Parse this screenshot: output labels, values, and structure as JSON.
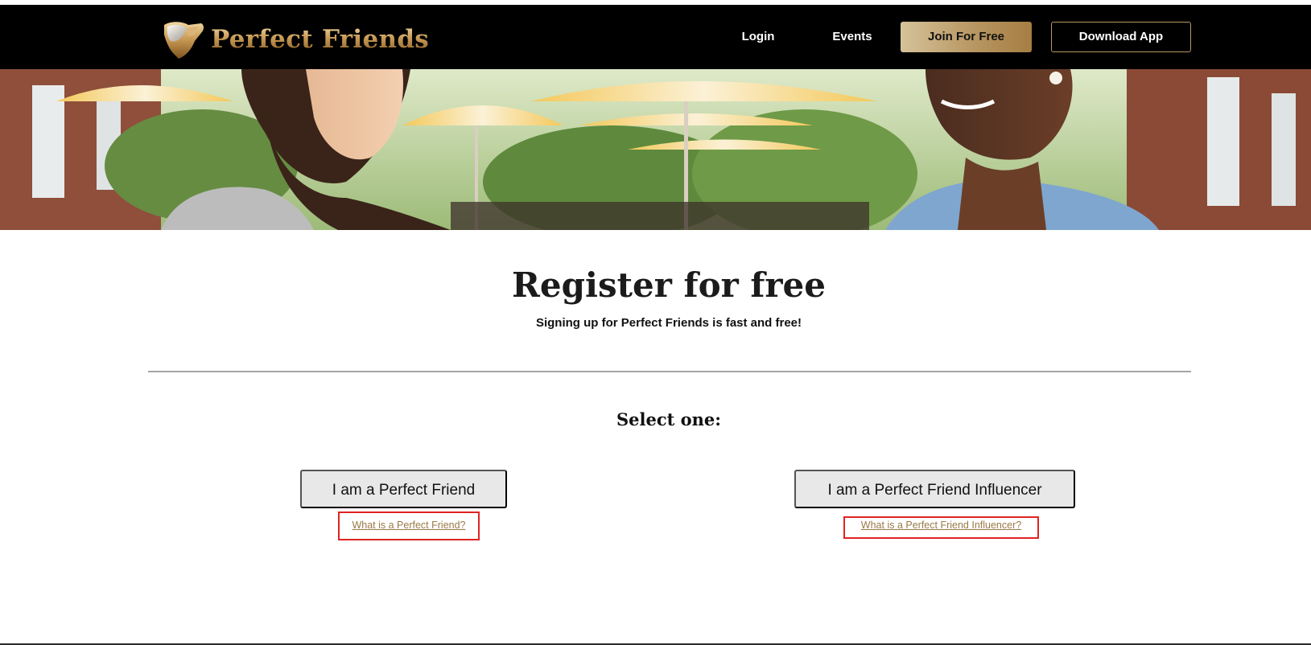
{
  "brand": {
    "name": "Perfect Friends",
    "logo_icon": "handshake-icon"
  },
  "nav": {
    "login": "Login",
    "events": "Events",
    "join": "Join For Free",
    "download": "Download App"
  },
  "hero": {
    "image_description": ""
  },
  "register": {
    "title": "Register for free",
    "subtitle": "Signing up for Perfect Friends is fast and free!",
    "select_label": "Select one:"
  },
  "options": [
    {
      "label": "I am a Perfect Friend",
      "help": "What is a Perfect Friend?"
    },
    {
      "label": "I am a Perfect Friend Influencer",
      "help": "What is a Perfect Friend Influencer?"
    }
  ],
  "colors": {
    "nav_bg": "#000000",
    "accent_gold": "#b89762",
    "link_gold": "#9a7a47",
    "highlight_red": "#e02323",
    "button_gray": "#e8e8e8"
  }
}
